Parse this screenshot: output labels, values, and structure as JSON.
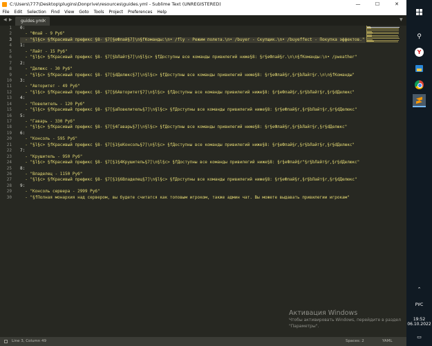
{
  "window": {
    "title": "C:\\Users\\777\\Desktop\\plugins\\Donprive\\resources\\guides.yml - Sublime Text (UNREGISTERED)",
    "minimize": "—",
    "maximize": "☐",
    "close": "✕"
  },
  "menu": [
    "File",
    "Edit",
    "Selection",
    "Find",
    "View",
    "Goto",
    "Tools",
    "Project",
    "Preferences",
    "Help"
  ],
  "tab": {
    "label": "guides.yml",
    "close": "×"
  },
  "editor": {
    "current_line": 3,
    "lines": [
      "0:",
      "  - \"Флай - 9 Руб\"",
      "  - \"§l§c> §fКрасивый префикс §8- §7[§eФлай§7]\\n§fКоманды:\\n• /fly - Режим полета.\\n• /buyer - Скупщик.\\n• /buyeffect - Покупка эффектов.\"",
      "1:",
      "  - \"Лайт - 15 Руб\"",
      "  - \"§l§c> §fКрасивый префикс §8- §7[§bЛайт§7]\\n§l§c> §fДоступны все команды привилегий ниже§8: §r§eФлай§r.\\n\\n§fКоманды:\\n• /pweather\"",
      "2:",
      "  - \"Делюкс - 30 Руб\"",
      "  - \"§l§c> §fКрасивый префикс §8- §7[§dДелюкс§7]\\n§l§c> §fДоступны все команды привилегий ниже§8: §r§eФлай§r,§r§bЛайт§r.\\n\\n§fКоманды\"",
      "3:",
      "  - \"Авторитет - 49 Руб\"",
      "  - \"§l§c> §fКрасивый префикс §8- §7[§6Авторитет§7]\\n§l§c> §fДоступны все команды привилегий ниже§8: §r§eФлай§r,§r§bЛайт§r,§r§dДелюкс\"",
      "4:",
      "  - \"Повелитель - 120 Руб\"",
      "  - \"§l§c> §fКрасивый префикс §8- §7[§aПовелитель§7]\\n§l§c> §fДоступны все команды привилегий ниже§8: §r§eФлай§r,§r§bЛайт§r,§r§dДелюкс\"",
      "5:",
      "  - \"Гаварь - 330 Руб\"",
      "  - \"§l§c> §fКрасивый префикс §8- §7[§4Гаварь§7]\\n§l§c> §fДоступны все команды привилегий ниже§8: §r§eФлай§r,§r§bЛайт§r,§r§dДелюкс\"",
      "6:",
      "  - \"Консоль - 595 Руб\"",
      "  - \"§l§c> §fКрасивый префикс §8- §7[§1§eКонсоль§7]\\n§l§c> §fДоступны все команды привилегий ниже§8: §r§eФлай§r,§r§bЛайт§r,§r§dДелюкс\"",
      "7:",
      "  - \"Крушитель - 950 Руб\"",
      "  - \"§l§c> §fКрасивый префикс §8- §7[§1§4Крушитель§7]\\n§l§c> §fДоступны все команды привилегий ниже§8: §r§eФлай§r\"§r§bЛайт§r,§r§dДелюкс\"",
      "8:",
      "  - \"Владелец - 1150 Руб\"",
      "  - \"§l§c> §fКрасивый префикс §8- §7[§1§6Владелец§7]\\n§l§c> §fДоступны все команды привилегий ниже§8: §r§eФлай§r,§r§bЛайт§r,§r§dДелюкс\"",
      "9:",
      "  - \"Консоль сервера - 2999 Руб\"",
      "  - \"§fПолная монархия над сервером, вы будете считатся как топовым игроком, также админ чат. Вы можете выдавать привилегии игрокам\""
    ]
  },
  "status": {
    "position": "Line 3, Column 49",
    "spaces": "Spaces: 2",
    "syntax": "YAML"
  },
  "watermark": {
    "title": "Активация Windows",
    "subtitle": "Чтобы активировать Windows, перейдите в раздел \"Параметры\"."
  },
  "taskbar": {
    "language": "РУС",
    "time": "19:52",
    "date": "06.10.2022"
  },
  "colors": {
    "editor_bg": "#272822",
    "string": "#e6db74",
    "gutter": "#8f908a",
    "taskbar_bg": "#101a23"
  }
}
